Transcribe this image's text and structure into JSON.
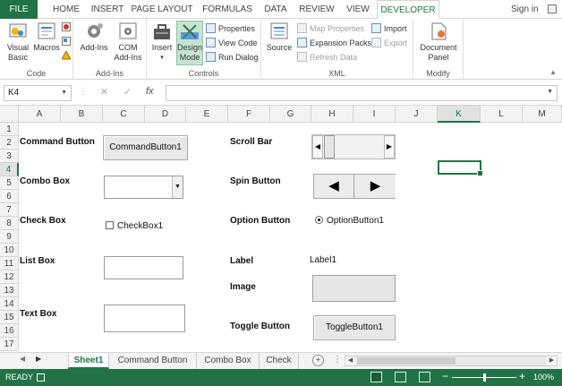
{
  "ribbon_tabs": {
    "file": "FILE",
    "home": "HOME",
    "insert": "INSERT",
    "page_layout": "PAGE LAYOUT",
    "formulas": "FORMULAS",
    "data": "DATA",
    "review": "REVIEW",
    "view": "VIEW",
    "developer": "DEVELOPER"
  },
  "sign_in": "Sign in",
  "ribbon": {
    "code": {
      "label": "Code",
      "visual_basic_1": "Visual",
      "visual_basic_2": "Basic",
      "macros": "Macros"
    },
    "addins": {
      "label": "Add-Ins",
      "addins_btn": "Add-Ins",
      "com_1": "COM",
      "com_2": "Add-Ins"
    },
    "controls": {
      "label": "Controls",
      "insert": "Insert",
      "design_1": "Design",
      "design_2": "Mode",
      "properties": "Properties",
      "view_code": "View Code",
      "run_dialog": "Run Dialog"
    },
    "xml": {
      "label": "XML",
      "source": "Source",
      "map_properties": "Map Properties",
      "expansion_packs": "Expansion Packs",
      "refresh_data": "Refresh Data",
      "import": "Import",
      "export": "Export"
    },
    "modify": {
      "label": "Modify",
      "doc_1": "Document",
      "doc_2": "Panel"
    }
  },
  "formula_bar": {
    "name_box": "K4",
    "formula": ""
  },
  "columns": [
    "A",
    "B",
    "C",
    "D",
    "E",
    "F",
    "G",
    "H",
    "I",
    "J",
    "K",
    "L",
    "M"
  ],
  "rows": [
    "1",
    "2",
    "3",
    "4",
    "5",
    "6",
    "7",
    "8",
    "9",
    "10",
    "11",
    "12",
    "13",
    "14",
    "15",
    "16",
    "17"
  ],
  "cells": {
    "command_button": "Command Button",
    "combo_box": "Combo Box",
    "check_box": "Check Box",
    "list_box": "List Box",
    "text_box": "Text Box",
    "scroll_bar": "Scroll Bar",
    "spin_button": "Spin Button",
    "option_button": "Option Button",
    "label": "Label",
    "image": "Image",
    "toggle_button": "Toggle Button"
  },
  "controls": {
    "command_button": "CommandButton1",
    "check_box": "CheckBox1",
    "option_button": "OptionButton1",
    "label": "Label1",
    "toggle_button": "ToggleButton1"
  },
  "sheet_tabs": [
    "Sheet1",
    "Command Button",
    "Combo Box",
    "Check"
  ],
  "status": {
    "ready": "READY",
    "zoom": "100%"
  },
  "colors": {
    "accent": "#217346"
  }
}
